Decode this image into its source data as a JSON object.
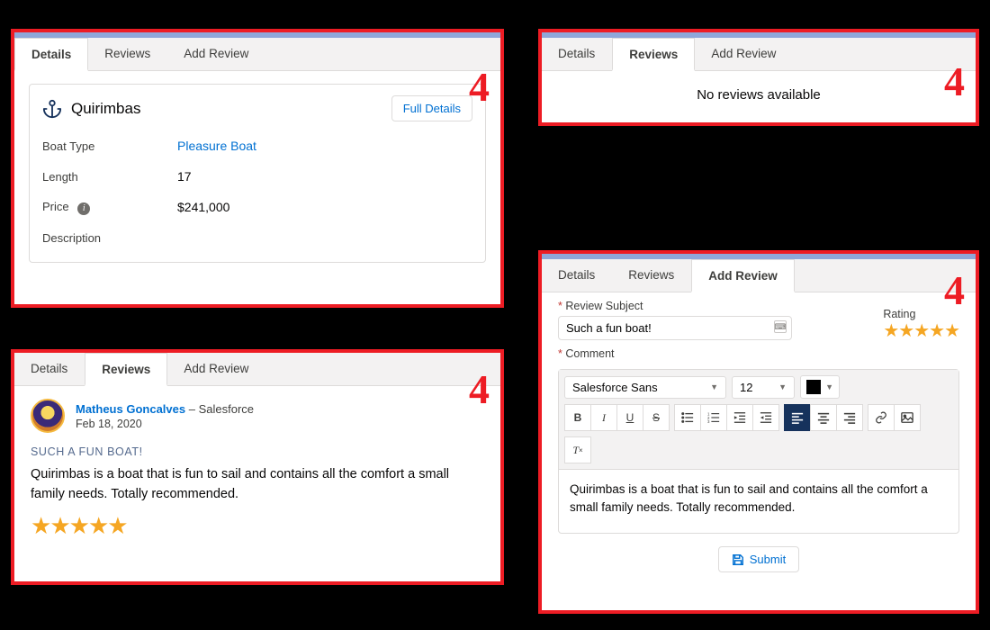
{
  "callout": "4",
  "tabs": {
    "details": "Details",
    "reviews": "Reviews",
    "add_review": "Add Review"
  },
  "details_panel": {
    "boat_name": "Quirimbas",
    "full_details_label": "Full Details",
    "fields": {
      "boat_type_label": "Boat Type",
      "boat_type_value": "Pleasure Boat",
      "length_label": "Length",
      "length_value": "17",
      "price_label": "Price",
      "price_value": "$241,000",
      "description_label": "Description"
    }
  },
  "no_reviews_panel": {
    "message": "No reviews available"
  },
  "review_panel": {
    "author_name": "Matheus Goncalves",
    "author_sep": " – ",
    "author_company": "Salesforce",
    "date": "Feb 18, 2020",
    "subject": "SUCH A FUN BOAT!",
    "text": "Quirimbas is a boat that is fun to sail and contains all the comfort a small family needs. Totally recommended.",
    "rating": 5
  },
  "add_review_panel": {
    "subject_label": "Review Subject",
    "subject_value": "Such a fun boat!",
    "rating_label": "Rating",
    "rating_value": 5,
    "comment_label": "Comment",
    "rte": {
      "font_family": "Salesforce Sans",
      "font_size": "12",
      "body": "Quirimbas is a boat that is fun to sail and contains all the comfort a small family needs. Totally recommended."
    },
    "submit_label": "Submit"
  }
}
